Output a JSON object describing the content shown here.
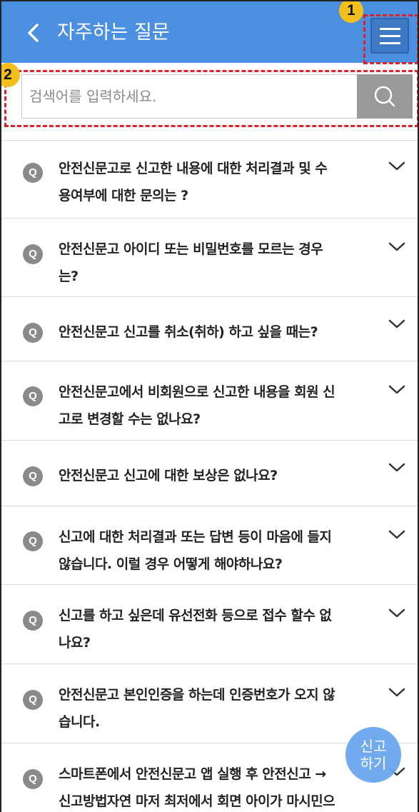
{
  "header": {
    "title": "자주하는 질문",
    "back_icon": "chevron-left-icon",
    "menu_icon": "hamburger-menu-icon",
    "background": "#4a8fe0"
  },
  "annotations": {
    "marker_1": "1",
    "marker_2": "2",
    "color": "#e0202a",
    "badge_color": "#f3bf1c"
  },
  "search": {
    "placeholder": "검색어를 입력하세요.",
    "value": "",
    "button_icon": "search-icon"
  },
  "faq": {
    "q_label": "Q",
    "expand_icon": "chevron-down-icon",
    "items": [
      {
        "line1": "안전신문고로 신고한 내용에 대한 처리결과 및 수",
        "line2": "용여부에 대한 문의는 ?"
      },
      {
        "line1": "안전신문고 아이디 또는 비밀번호를 모르는 경우",
        "line2": "는?"
      },
      {
        "line1": "안전신문고 신고를 취소(취하) 하고 싶을 때는?",
        "line2": ""
      },
      {
        "line1": "안전신문고에서 비회원으로 신고한 내용을 회원 신",
        "line2": "고로 변경할 수는 없나요?"
      },
      {
        "line1": "안전신문고 신고에 대한 보상은 없나요?",
        "line2": ""
      },
      {
        "line1": "신고에 대한 처리결과 또는 답변 등이 마음에 들지",
        "line2": "않습니다. 이럴 경우 어떻게 해야하나요?"
      },
      {
        "line1": "신고를 하고 싶은데 유선전화 등으로 접수 할수 없",
        "line2": "나요?"
      },
      {
        "line1": "안전신문고 본인인증을 하는데 인증번호가 오지 않",
        "line2": "습니다."
      },
      {
        "line1": "스마트폰에서 안전신문고 앱 실행 후 안전신고 →",
        "line2": "신고방법자연 마저 최저에서 회면 아이가 마시민으"
      }
    ]
  },
  "fab": {
    "line1": "신고",
    "line2": "하기",
    "color": "#6aa6ee"
  }
}
